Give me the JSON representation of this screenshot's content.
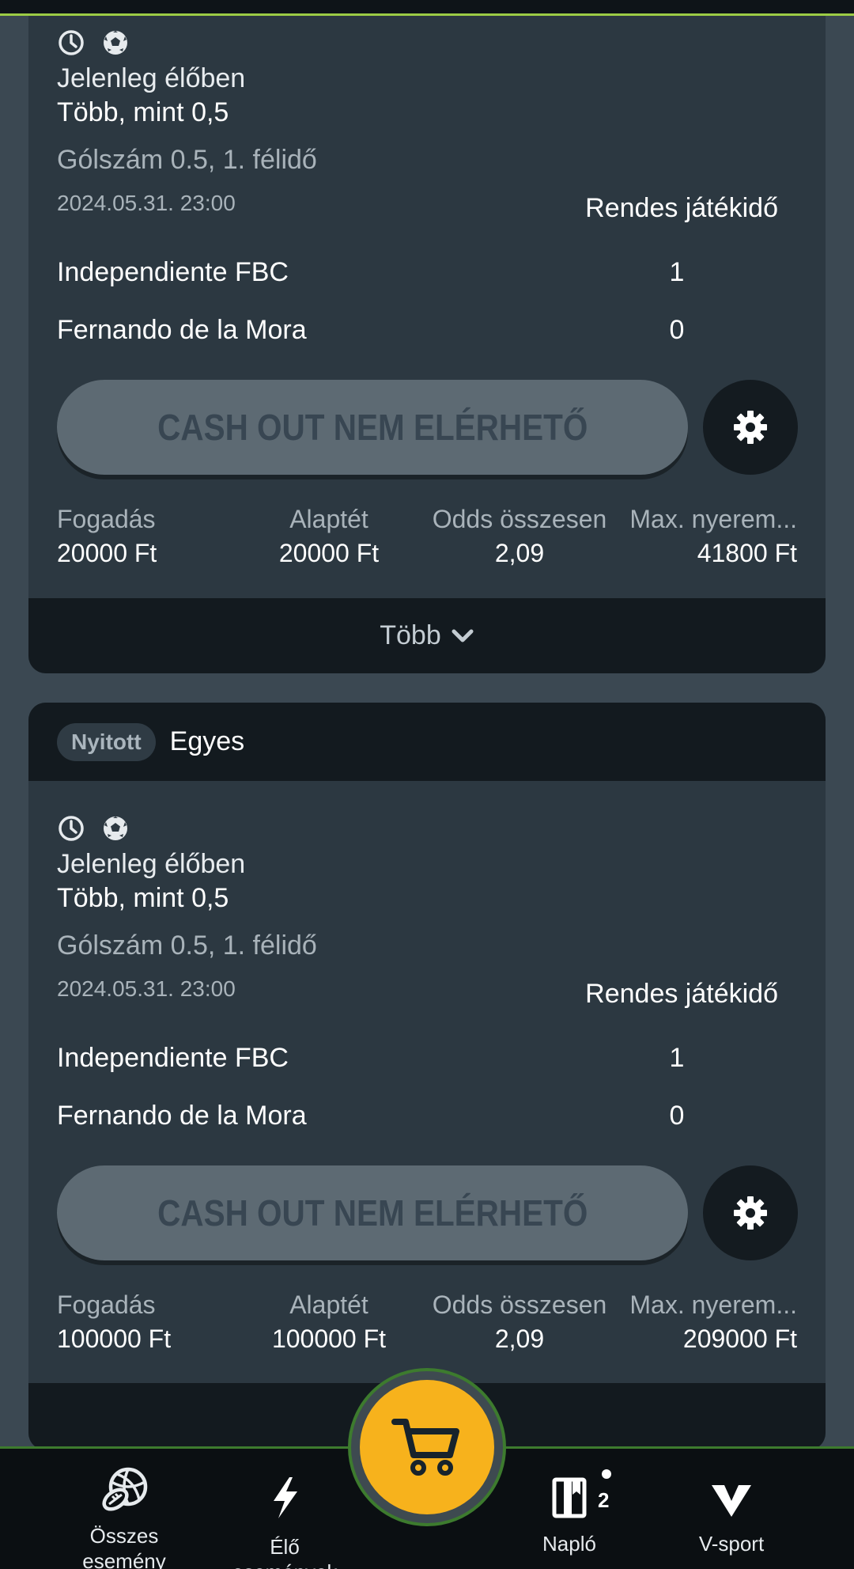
{
  "cards": [
    {
      "status_live": "Jelenleg élőben",
      "selection": "Több, mint 0,5",
      "market": "Gólszám 0.5, 1. félidő",
      "date": "2024.05.31.",
      "time": "23:00",
      "period": "Rendes játékidő",
      "team1": "Independiente FBC",
      "score1": "1",
      "team2": "Fernando de la Mora",
      "score2": "0",
      "cashout_label": "CASH OUT NEM ELÉRHETŐ",
      "stats": {
        "stake_label": "Fogadás",
        "stake_value": "20000 Ft",
        "base_label": "Alaptét",
        "base_value": "20000 Ft",
        "odds_label": "Odds összesen",
        "odds_value": "2,09",
        "max_label": "Max. nyerem...",
        "max_value": "41800 Ft"
      },
      "more_label": "Több"
    },
    {
      "badge": "Nyitott",
      "bet_type": "Egyes",
      "status_live": "Jelenleg élőben",
      "selection": "Több, mint 0,5",
      "market": "Gólszám 0.5, 1. félidő",
      "date": "2024.05.31.",
      "time": "23:00",
      "period": "Rendes játékidő",
      "team1": "Independiente FBC",
      "score1": "1",
      "team2": "Fernando de la Mora",
      "score2": "0",
      "cashout_label": "CASH OUT NEM ELÉRHETŐ",
      "stats": {
        "stake_label": "Fogadás",
        "stake_value": "100000 Ft",
        "base_label": "Alaptét",
        "base_value": "100000 Ft",
        "odds_label": "Odds összesen",
        "odds_value": "2,09",
        "max_label": "Max. nyerem...",
        "max_value": "209000 Ft"
      }
    }
  ],
  "nav": {
    "all_events": "Összes esemény",
    "live_events": "Élő események",
    "log": "Napló",
    "log_count": "2",
    "vsport": "V-sport"
  },
  "icons": {
    "clock": "clock-icon",
    "soccer": "soccer-ball-icon",
    "gear": "gear-icon",
    "chevron": "chevron-down-icon",
    "cart": "cart-icon",
    "all_sports": "sports-balls-icon",
    "lightning": "lightning-icon",
    "book": "book-icon",
    "vsport": "v-logo-icon"
  },
  "colors": {
    "accent": "#f7b21c",
    "green_line": "#9ccc45",
    "card_bg": "#2c3841",
    "header_bg": "#131a1f"
  }
}
